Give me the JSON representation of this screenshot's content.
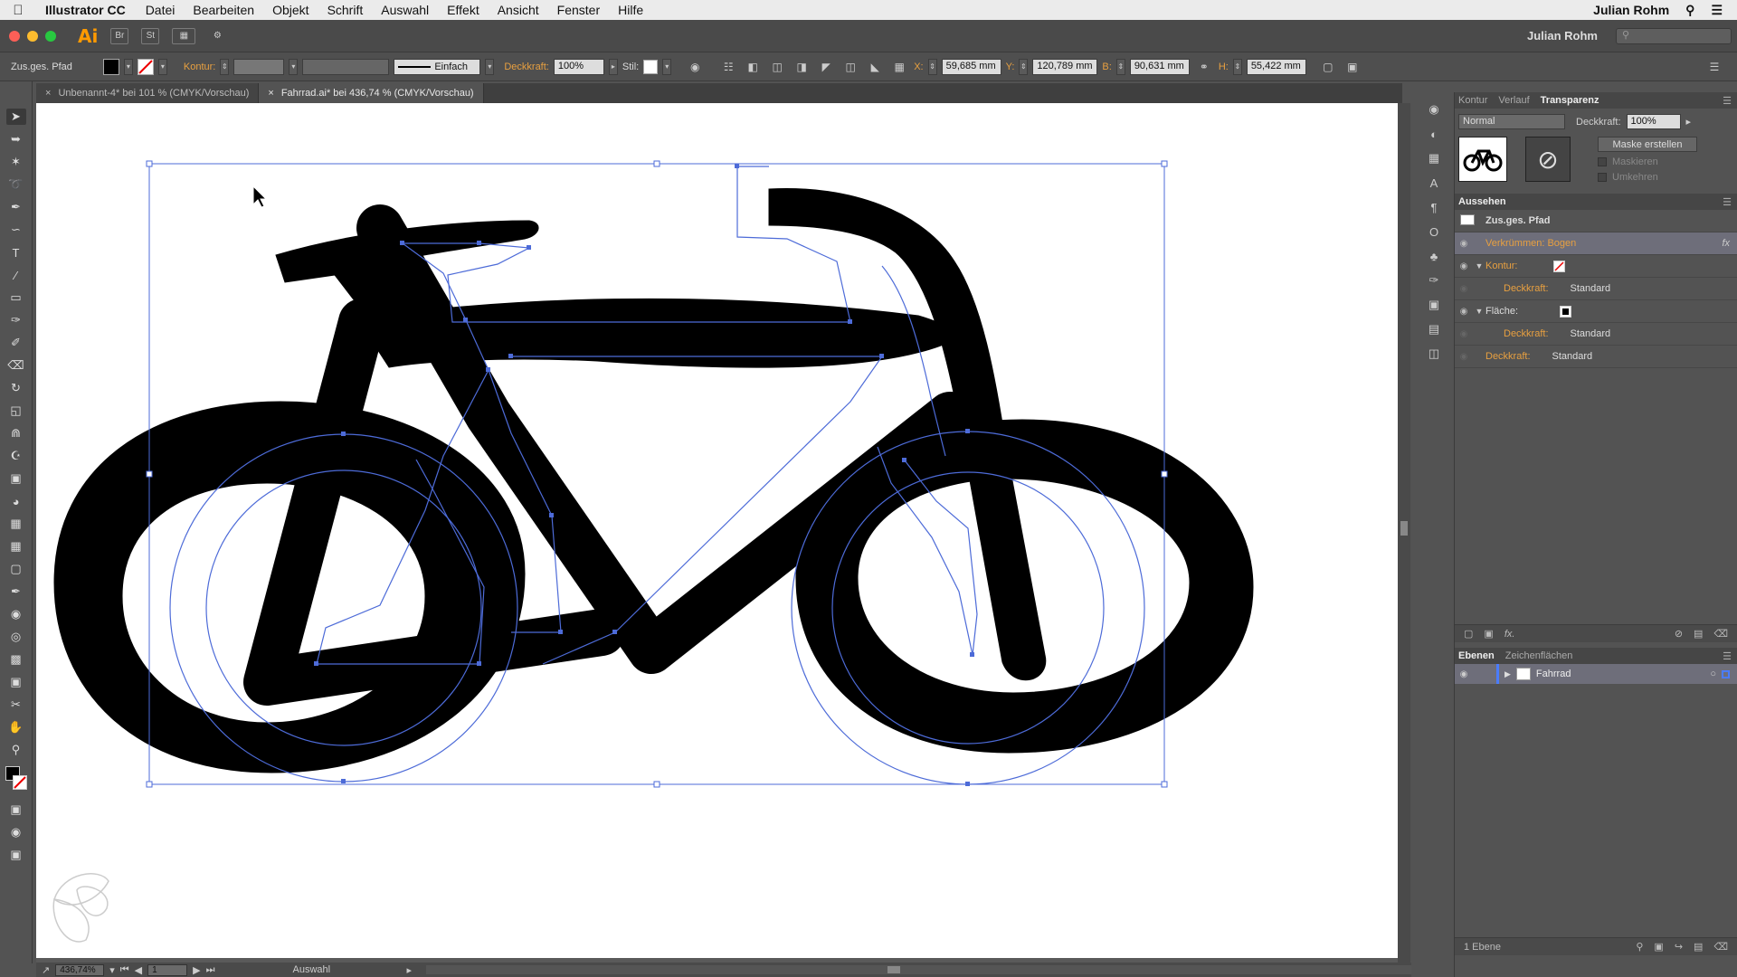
{
  "menubar": {
    "app_name": "Illustrator CC",
    "items": [
      "Datei",
      "Bearbeiten",
      "Objekt",
      "Schrift",
      "Auswahl",
      "Effekt",
      "Ansicht",
      "Fenster",
      "Hilfe"
    ],
    "user": "Julian Rohm"
  },
  "appbar": {
    "logo": "Ai",
    "br": "Br",
    "st": "St",
    "workspace_user": "Julian Rohm"
  },
  "control": {
    "selection_type": "Zus.ges. Pfad",
    "kontur_label": "Kontur:",
    "stroke_style": "Einfach",
    "opacity_label": "Deckkraft:",
    "opacity_value": "100%",
    "style_label": "Stil:",
    "x_label": "X:",
    "x_value": "59,685 mm",
    "y_label": "Y:",
    "y_value": "120,789 mm",
    "b_label": "B:",
    "b_value": "90,631 mm",
    "h_label": "H:",
    "h_value": "55,422 mm"
  },
  "tabs": [
    {
      "label": "Unbenannt-4* bei 101 % (CMYK/Vorschau)",
      "active": false
    },
    {
      "label": "Fahrrad.ai* bei 436,74 % (CMYK/Vorschau)",
      "active": true
    }
  ],
  "status": {
    "zoom": "436,74%",
    "page": "1",
    "tool": "Auswahl"
  },
  "transparency_panel": {
    "tabs": [
      "Kontur",
      "Verlauf",
      "Transparenz"
    ],
    "blend_mode": "Normal",
    "opacity_label": "Deckkraft:",
    "opacity_value": "100%",
    "make_mask": "Maske erstellen",
    "clip": "Maskieren",
    "invert": "Umkehren"
  },
  "appearance_panel": {
    "title": "Aussehen",
    "object": "Zus.ges. Pfad",
    "effect": "Verkrümmen: Bogen",
    "kontur": "Kontur:",
    "deckkraft": "Deckkraft:",
    "standard": "Standard",
    "flaeche": "Fläche:"
  },
  "layers_panel": {
    "tabs": [
      "Ebenen",
      "Zeichenflächen"
    ],
    "layer_name": "Fahrrad",
    "count": "1 Ebene"
  },
  "colors": {
    "accent_orange": "#ff9a00",
    "selection_blue": "#4d6bd8",
    "label_orange": "#e8a040"
  }
}
